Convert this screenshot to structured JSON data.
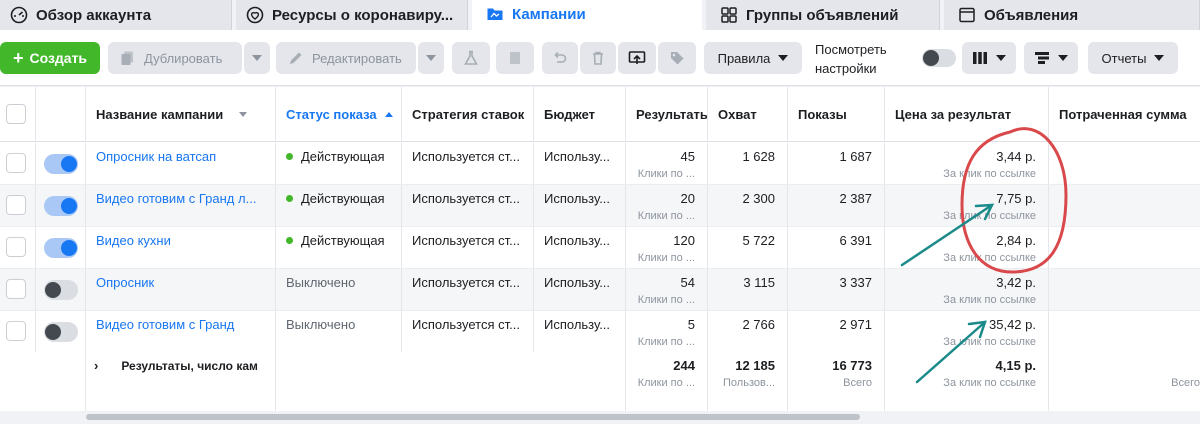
{
  "tabs": [
    {
      "label": "Обзор аккаунта",
      "icon": "gauge-icon"
    },
    {
      "label": "Ресурсы о коронавиру...",
      "icon": "heart-shield-icon"
    },
    {
      "label": "Кампании",
      "icon": "folder-icon"
    },
    {
      "label": "Группы объявлений",
      "icon": "grid-icon"
    },
    {
      "label": "Объявления",
      "icon": "ad-icon"
    }
  ],
  "toolbar": {
    "create": "Создать",
    "duplicate": "Дублировать",
    "edit": "Редактировать",
    "rules": "Правила",
    "view_settings": [
      "Посмотреть",
      "настройки"
    ],
    "reports": "Отчеты"
  },
  "columns": {
    "name": "Название кампании",
    "status": "Статус показа",
    "strategy": "Стратегия ставок",
    "budget": "Бюджет",
    "results": "Результаты",
    "reach": "Охват",
    "impressions": "Показы",
    "cpr": "Цена за результат",
    "spent": "Потраченная сумма"
  },
  "rows": [
    {
      "name": "Опросник на ватсап",
      "status": "Действующая",
      "active": true,
      "strategy": "Используется ст...",
      "budget": "Использу...",
      "results": "45",
      "results_sub": "Клики по ...",
      "reach": "1 628",
      "impressions": "1 687",
      "cpr": "3,44 р.",
      "cpr_sub": "За клик по ссылке"
    },
    {
      "name": "Видео готовим с Гранд л...",
      "status": "Действующая",
      "active": true,
      "strategy": "Используется ст...",
      "budget": "Использу...",
      "results": "20",
      "results_sub": "Клики по ...",
      "reach": "2 300",
      "impressions": "2 387",
      "cpr": "7,75 р.",
      "cpr_sub": "За клик по ссылке"
    },
    {
      "name": "Видео кухни",
      "status": "Действующая",
      "active": true,
      "strategy": "Используется ст...",
      "budget": "Использу...",
      "results": "120",
      "results_sub": "Клики по ...",
      "reach": "5 722",
      "impressions": "6 391",
      "cpr": "2,84 р.",
      "cpr_sub": "За клик по ссылке"
    },
    {
      "name": "Опросник",
      "status": "Выключено",
      "active": false,
      "strategy": "Используется ст...",
      "budget": "Использу...",
      "results": "54",
      "results_sub": "Клики по ...",
      "reach": "3 115",
      "impressions": "3 337",
      "cpr": "3,42 р.",
      "cpr_sub": "За клик по ссылке"
    },
    {
      "name": "Видео готовим с Гранд",
      "status": "Выключено",
      "active": false,
      "strategy": "Используется ст...",
      "budget": "Использу...",
      "results": "5",
      "results_sub": "Клики по ...",
      "reach": "2 766",
      "impressions": "2 971",
      "cpr": "35,42 р.",
      "cpr_sub": "За клик по ссылке"
    }
  ],
  "totals": {
    "label": "Результаты, число кам",
    "results": "244",
    "results_sub": "Клики по ...",
    "reach": "12 185",
    "reach_sub": "Пользов...",
    "impressions": "16 773",
    "impressions_sub": "Всего",
    "cpr": "4,15 р.",
    "cpr_sub": "За клик по ссылке",
    "spent_sub": "Всего"
  },
  "colors": {
    "accent": "#1877f2",
    "create": "#42b72a",
    "annotation_circle": "#d9484b",
    "annotation_arrow": "#1a8a8a"
  }
}
